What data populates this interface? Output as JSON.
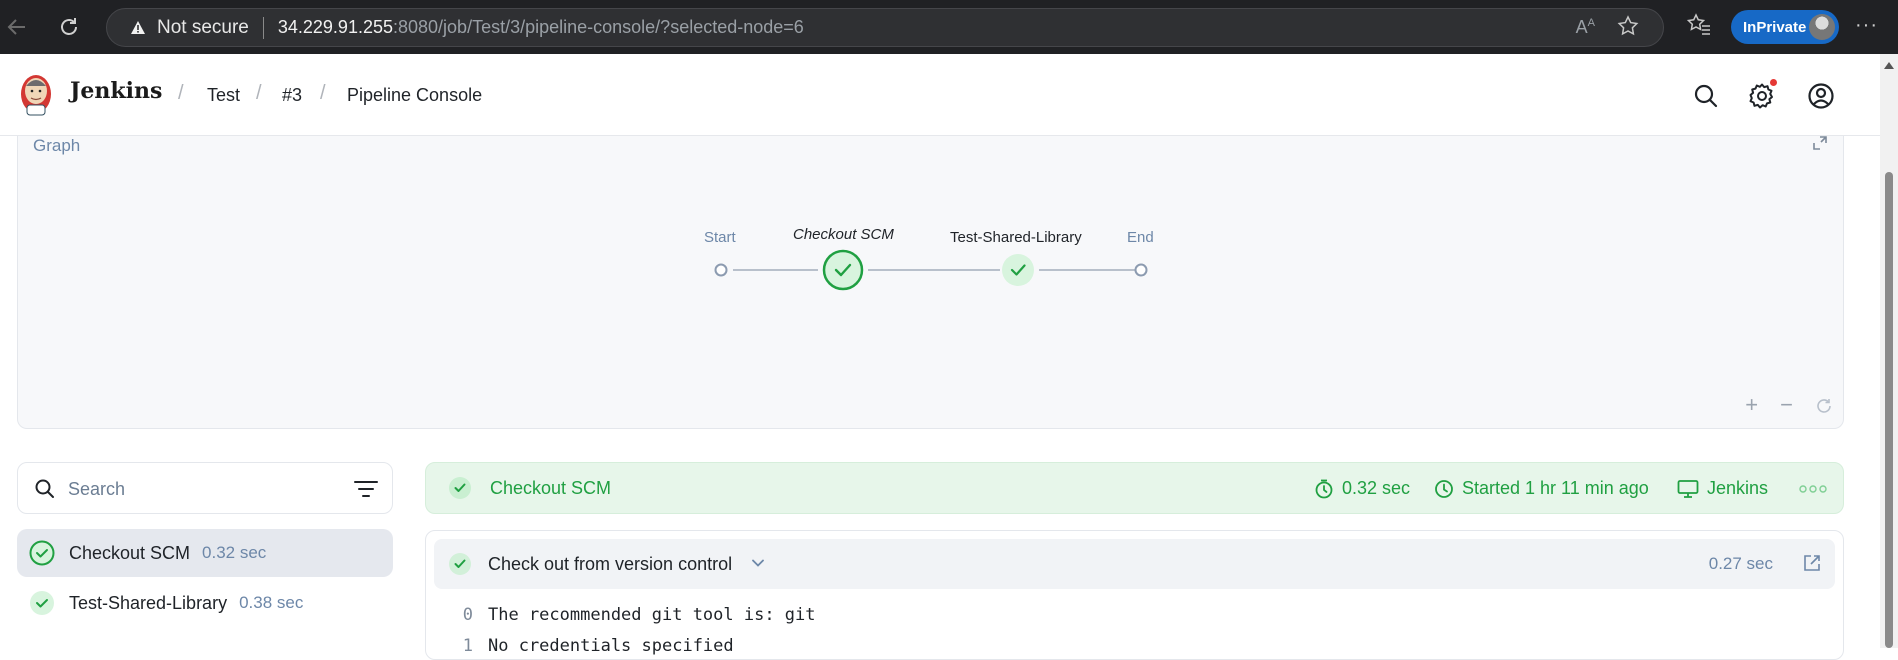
{
  "browser": {
    "not_secure": "Not secure",
    "url_host": "34.229.91.255",
    "url_rest": ":8080/job/Test/3/pipeline-console/?selected-node=6",
    "inprivate": "InPrivate",
    "icons": [
      "back-icon",
      "reload-icon",
      "warning-icon",
      "read-aloud-icon",
      "favorite-star-icon",
      "favorites-icon",
      "more-icon"
    ]
  },
  "header": {
    "brand": "Jenkins",
    "breadcrumbs": [
      "Test",
      "#3",
      "Pipeline Console"
    ],
    "icons": [
      "search-icon",
      "gear-icon",
      "user-icon"
    ]
  },
  "graph": {
    "label": "Graph",
    "nodes": [
      "Start",
      "Checkout SCM",
      "Test-Shared-Library",
      "End"
    ],
    "selected_node": "Checkout SCM",
    "zoom_in": "+",
    "zoom_out": "−"
  },
  "sidebar": {
    "search_placeholder": "Search",
    "stages": [
      {
        "name": "Checkout SCM",
        "duration": "0.32 sec",
        "status": "success",
        "active": true
      },
      {
        "name": "Test-Shared-Library",
        "duration": "0.38 sec",
        "status": "success",
        "active": false
      }
    ]
  },
  "stage_detail": {
    "title": "Checkout SCM",
    "duration": "0.32 sec",
    "started": "Started 1 hr 11 min ago",
    "agent": "Jenkins",
    "step": {
      "title": "Check out from version control",
      "duration": "0.27 sec"
    },
    "log": [
      {
        "n": "0",
        "text": "The recommended git tool is: git"
      },
      {
        "n": "1",
        "text": "No credentials specified"
      }
    ]
  },
  "colors": {
    "success": "#20a042",
    "success_bg": "#e7f6ea",
    "muted_blue": "#6d87a8",
    "inprivate": "#1769c6"
  }
}
